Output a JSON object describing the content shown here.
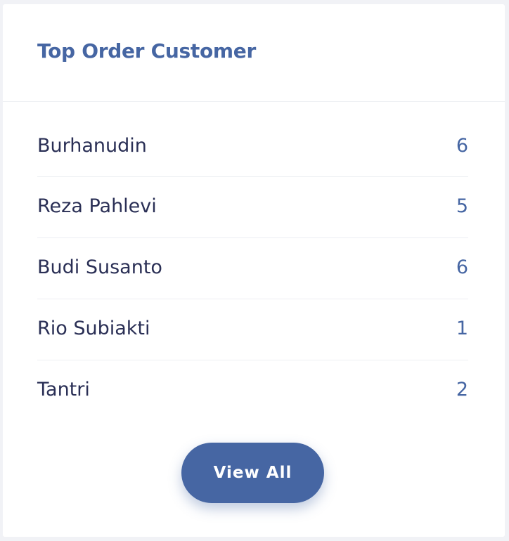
{
  "card": {
    "title": "Top Order Customer",
    "customers": [
      {
        "name": "Burhanudin",
        "orders": "6"
      },
      {
        "name": "Reza Pahlevi",
        "orders": "5"
      },
      {
        "name": "Budi Susanto",
        "orders": "6"
      },
      {
        "name": "Rio Subiakti",
        "orders": "1"
      },
      {
        "name": "Tantri",
        "orders": "2"
      }
    ],
    "button_label": "View All"
  },
  "colors": {
    "accent": "#4666a3",
    "text": "#2a2f55",
    "background": "#f1f2f6",
    "card": "#ffffff"
  }
}
